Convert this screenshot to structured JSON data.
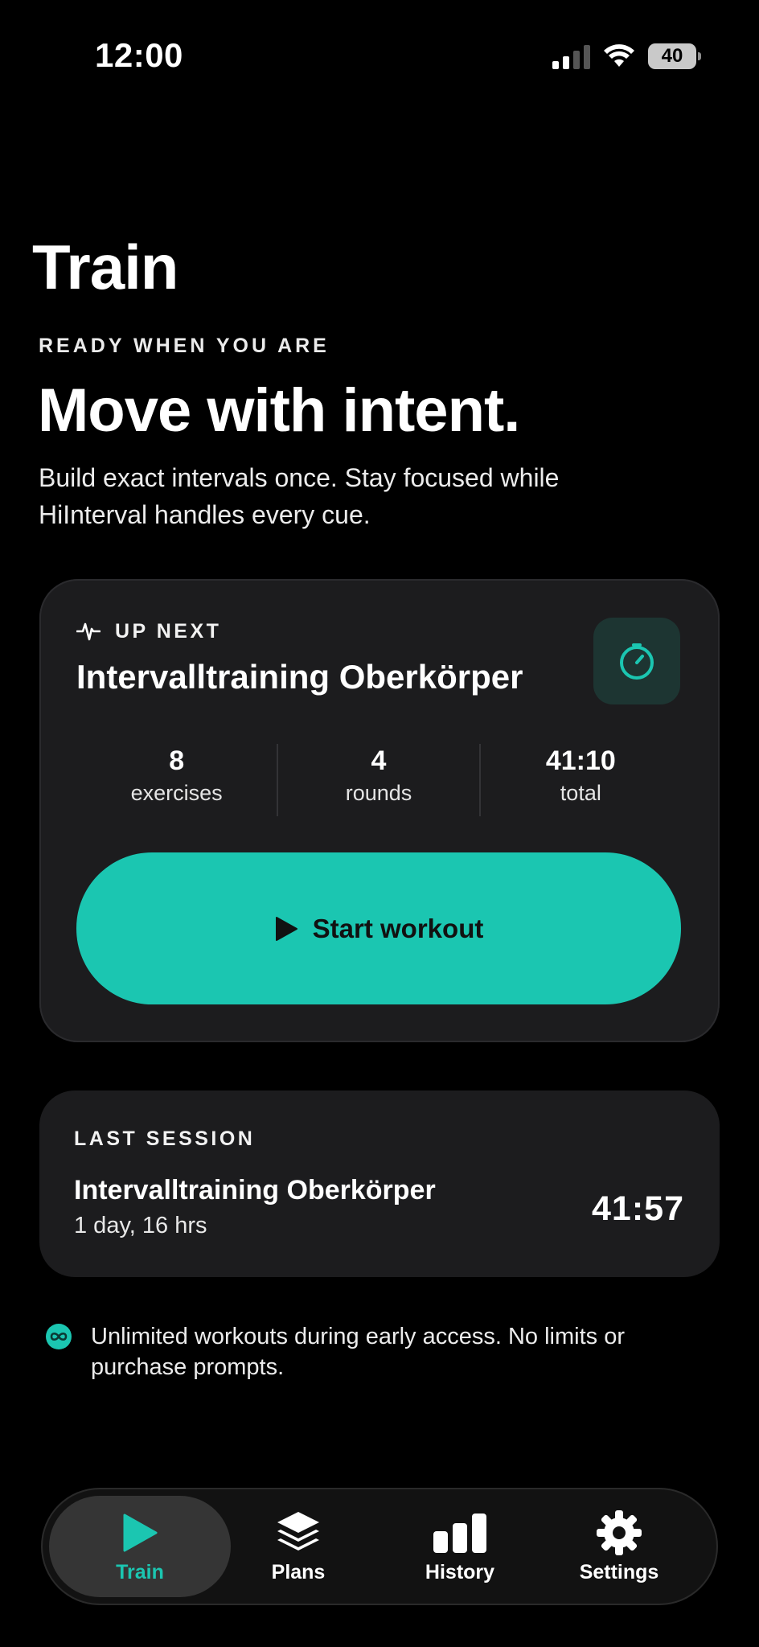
{
  "status_bar": {
    "time": "12:00",
    "battery": "40",
    "icons": [
      "signal-icon",
      "wifi-icon",
      "battery-icon"
    ]
  },
  "page": {
    "title": "Train",
    "eyebrow": "READY WHEN YOU ARE",
    "headline": "Move with intent.",
    "subtitle": "Build exact intervals once. Stay focused while HiInterval handles every cue."
  },
  "up_next": {
    "label": "UP NEXT",
    "title": "Intervalltraining Oberkörper",
    "stats": [
      {
        "value": "8",
        "label": "exercises"
      },
      {
        "value": "4",
        "label": "rounds"
      },
      {
        "value": "41:10",
        "label": "total"
      }
    ],
    "start_label": "Start workout",
    "icons": [
      "activity-icon",
      "timer-icon",
      "play-icon"
    ]
  },
  "last_session": {
    "label": "LAST SESSION",
    "title": "Intervalltraining Oberkörper",
    "time_ago": "1 day, 16 hrs",
    "duration": "41:57"
  },
  "note": {
    "text": "Unlimited workouts during early access. No limits or purchase prompts.",
    "icon": "infinity-icon"
  },
  "tabs": [
    {
      "label": "Train",
      "icon": "play-icon",
      "active": true
    },
    {
      "label": "Plans",
      "icon": "layers-icon",
      "active": false
    },
    {
      "label": "History",
      "icon": "bar-chart-icon",
      "active": false
    },
    {
      "label": "Settings",
      "icon": "gear-icon",
      "active": false
    }
  ],
  "colors": {
    "accent": "#1bc6b1",
    "background": "#000000",
    "card": "#1c1c1e",
    "timer_tile": "#1d3532"
  }
}
